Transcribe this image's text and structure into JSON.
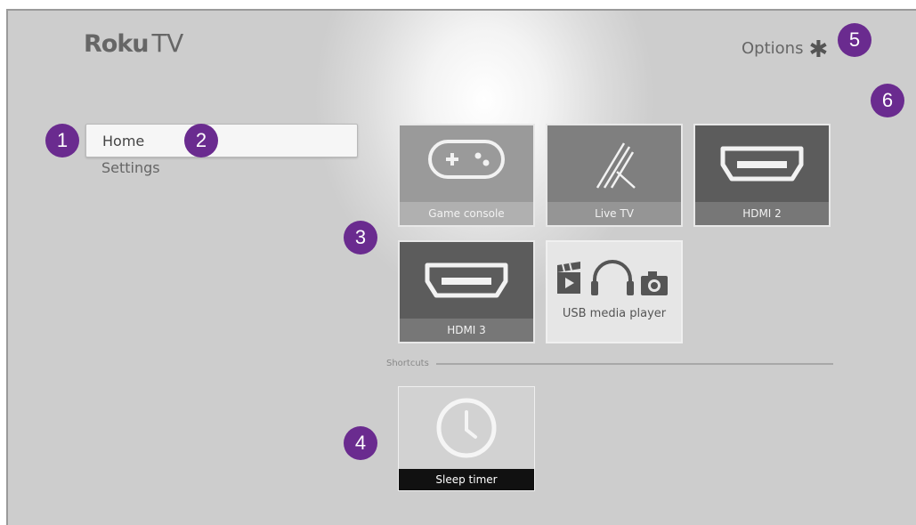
{
  "app": {
    "logo_brand": "Roku",
    "logo_suffix": "TV"
  },
  "header": {
    "options_label": "Options",
    "options_icon": "asterisk-icon"
  },
  "menu": {
    "items": [
      {
        "label": "Home",
        "selected": true
      },
      {
        "label": "Settings",
        "selected": false
      }
    ]
  },
  "tiles": [
    {
      "label": "Game console",
      "icon": "gamepad-icon"
    },
    {
      "label": "Live TV",
      "icon": "antenna-icon"
    },
    {
      "label": "HDMI 2",
      "icon": "hdmi-icon"
    },
    {
      "label": "HDMI 3",
      "icon": "hdmi-icon"
    },
    {
      "label": "USB media player",
      "icon": "media-icons"
    }
  ],
  "shortcuts": {
    "heading": "Shortcuts",
    "items": [
      {
        "label": "Sleep timer",
        "icon": "clock-icon"
      }
    ]
  },
  "annotations": [
    "1",
    "2",
    "3",
    "4",
    "5",
    "6"
  ],
  "colors": {
    "badge": "#6a2b8f",
    "background": "#cdcdcd"
  }
}
